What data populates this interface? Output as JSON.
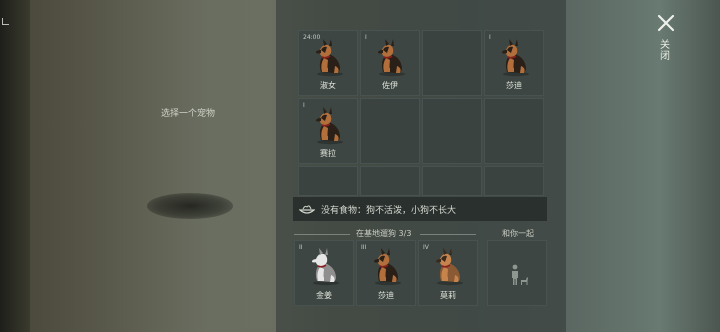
{
  "left_panel": {
    "hint": "选择一个宠物"
  },
  "close": {
    "label": "关闭"
  },
  "grid": [
    {
      "level": "24:00",
      "name": "淑女",
      "coat": "shepherd"
    },
    {
      "level": "I",
      "name": "佐伊",
      "coat": "shepherd"
    },
    {
      "level": "",
      "name": "",
      "coat": ""
    },
    {
      "level": "I",
      "name": "莎迪",
      "coat": "shepherd"
    },
    {
      "level": "I",
      "name": "赛拉",
      "coat": "shepherd"
    },
    {
      "level": "",
      "name": "",
      "coat": ""
    },
    {
      "level": "",
      "name": "",
      "coat": ""
    },
    {
      "level": "",
      "name": "",
      "coat": ""
    },
    {
      "level": "",
      "name": "",
      "coat": ""
    },
    {
      "level": "",
      "name": "",
      "coat": ""
    },
    {
      "level": "",
      "name": "",
      "coat": ""
    },
    {
      "level": "",
      "name": "",
      "coat": ""
    }
  ],
  "food_notice": {
    "text": "没有食物：狗不活泼，小狗不长大",
    "icon": "food-bowl-icon"
  },
  "base_section": {
    "title": "在基地遛狗",
    "count": "3/3",
    "dogs": [
      {
        "level": "II",
        "name": "金姜",
        "coat": "husky"
      },
      {
        "level": "III",
        "name": "莎迪",
        "coat": "shepherd"
      },
      {
        "level": "IV",
        "name": "莫莉",
        "coat": "shepherd-light"
      }
    ]
  },
  "companion_section": {
    "title": "和你一起",
    "icon": "person-with-dog-icon"
  },
  "colors": {
    "shepherd_dark": "#2a2018",
    "shepherd_tan": "#b26f3c",
    "husky_white": "#e6e6e6",
    "husky_grey": "#8f8f8f",
    "collar": "#8a1f1f"
  }
}
